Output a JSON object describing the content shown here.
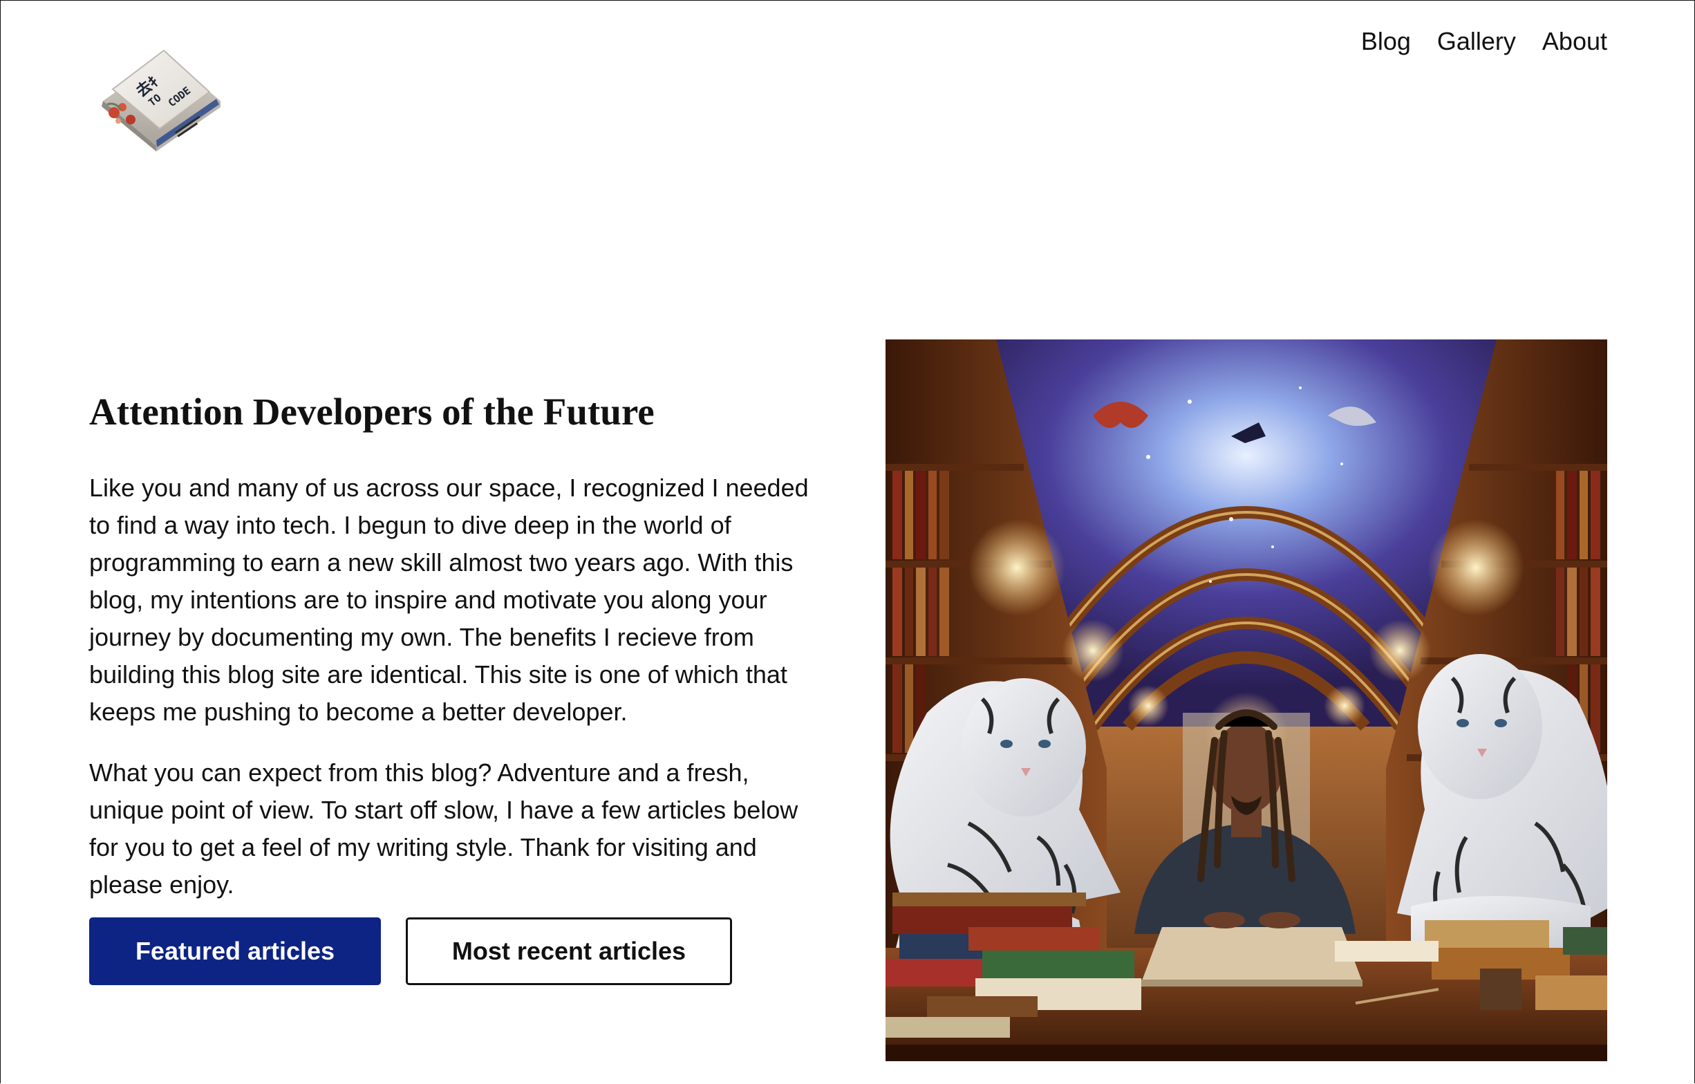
{
  "logo": {
    "text_top": "去ｷ",
    "text_middle": "TO",
    "text_bottom": "CODE"
  },
  "nav": {
    "items": [
      {
        "label": "Blog"
      },
      {
        "label": "Gallery"
      },
      {
        "label": "About"
      }
    ]
  },
  "hero": {
    "title": "Attention Developers of the Future",
    "paragraphs": [
      "Like you and many of us across our space, I recognized I needed to find a way into tech. I begun to dive deep in the world of programming to earn a new skill almost two years ago. With this blog, my intentions are to inspire and motivate you along your journey by documenting my own. The benefits I recieve from building this blog site are identical. This site is one of which that keeps me pushing to become a better developer.",
      "What you can expect from this blog? Adventure and a fresh, unique point of view. To start off slow, I have a few articles below for you to get a feel of my writing style. Thank for visiting and please enjoy."
    ],
    "buttons": {
      "featured": "Featured articles",
      "recent": "Most recent articles"
    }
  },
  "colors": {
    "primary_button": "#0d2484",
    "text": "#111111",
    "background": "#ffffff"
  },
  "icons": {
    "logo": "keycap-logo-icon",
    "hero_image": "library-illustration"
  }
}
